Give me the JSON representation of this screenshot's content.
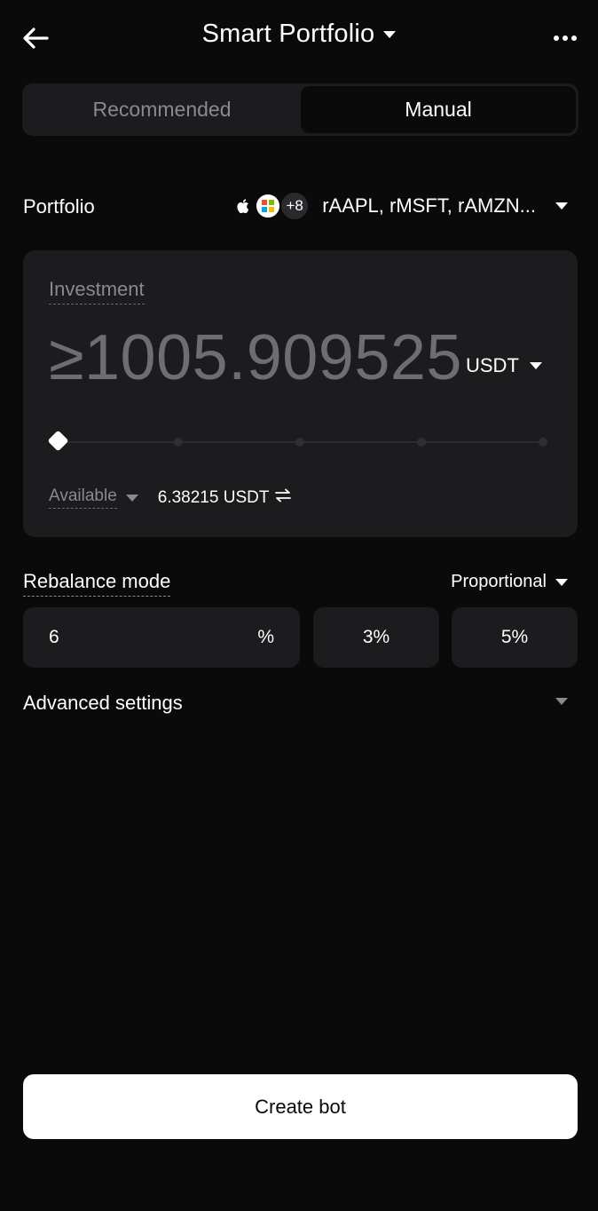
{
  "header": {
    "title": "Smart Portfolio"
  },
  "tabs": [
    {
      "label": "Recommended",
      "active": false
    },
    {
      "label": "Manual",
      "active": true
    }
  ],
  "portfolio": {
    "label": "Portfolio",
    "extra_count": "+8",
    "tickers": "rAAPL, rMSFT, rAMZN..."
  },
  "investment": {
    "label": "Investment",
    "amount": "≥1005.909525",
    "currency": "USDT",
    "slider_level": 0,
    "available_label": "Available",
    "available_value": "6.38215 USDT"
  },
  "rebalance": {
    "label": "Rebalance mode",
    "mode": "Proportional",
    "threshold_value": "6",
    "threshold_unit": "%",
    "presets": [
      "3%",
      "5%"
    ]
  },
  "advanced": {
    "label": "Advanced settings"
  },
  "actions": {
    "create_label": "Create bot"
  },
  "colors": {
    "background": "#0a0a0a",
    "card": "#1c1c1f",
    "muted_text": "#8a8a8e",
    "amount_text": "#6d6d72",
    "primary_button": "#ffffff"
  }
}
